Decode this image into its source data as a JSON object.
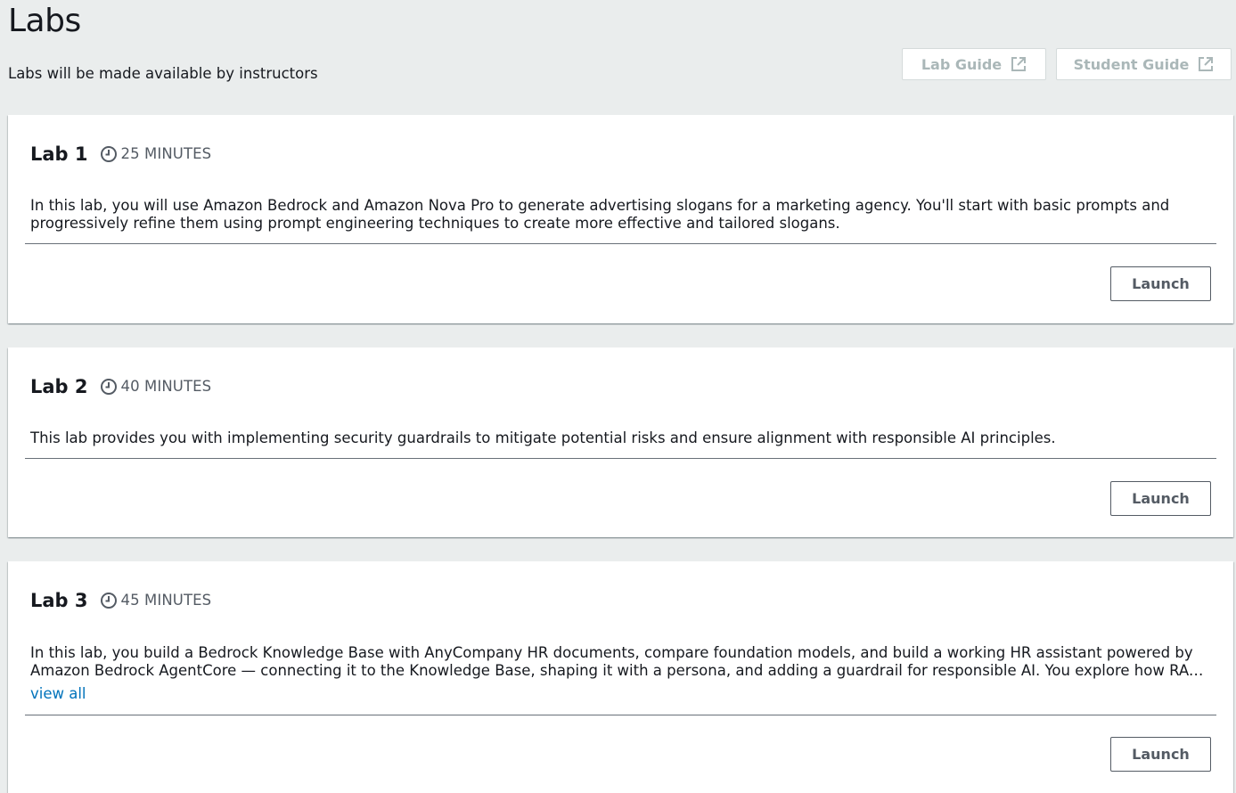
{
  "page": {
    "title": "Labs",
    "subtitle": "Labs will be made available by instructors"
  },
  "header_buttons": {
    "lab_guide": "Lab Guide",
    "student_guide": "Student Guide"
  },
  "labs": [
    {
      "name": "Lab 1",
      "duration": "25 MINUTES",
      "description": "In this lab, you will use Amazon Bedrock and Amazon Nova Pro to generate advertising slogans for a marketing agency. You'll start with basic prompts and progressively refine them using prompt engineering techniques to create more effective and tailored slogans.",
      "launch_label": "Launch"
    },
    {
      "name": "Lab 2",
      "duration": "40 MINUTES",
      "description": "This lab provides you with implementing security guardrails to mitigate potential risks and ensure alignment with responsible AI principles.",
      "launch_label": "Launch"
    },
    {
      "name": "Lab 3",
      "duration": "45 MINUTES",
      "description": "In this lab, you build a Bedrock Knowledge Base with AnyCompany HR documents, compare foundation models, and build a working HR assistant powered by Amazon Bedrock AgentCore — connecting it to the Knowledge Base, shaping it with a persona, and adding a guardrail for responsible AI. You explore how RAG and guardrails work together to deliver accurate, safe answers.",
      "view_all_label": "view all",
      "launch_label": "Launch"
    }
  ],
  "icons": {
    "clock": "clock-icon",
    "external_link": "external-link-icon"
  },
  "colors": {
    "background": "#eaeded",
    "link": "#0073bb",
    "disabled_text": "#aab7b8"
  }
}
